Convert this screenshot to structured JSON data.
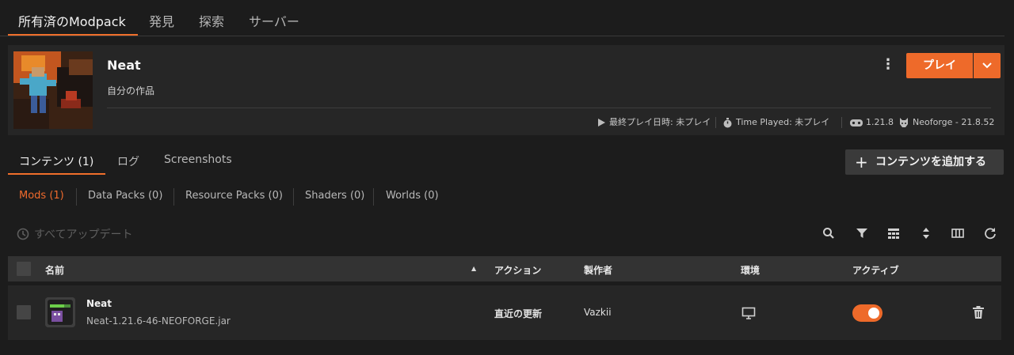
{
  "topnav": {
    "tabs": [
      {
        "label": "所有済のModpack",
        "active": true
      },
      {
        "label": "発見",
        "active": false
      },
      {
        "label": "探索",
        "active": false
      },
      {
        "label": "サーバー",
        "active": false
      }
    ]
  },
  "pack": {
    "title": "Neat",
    "subtitle": "自分の作品",
    "play_label": "プレイ",
    "meta": {
      "last_played": "最終プレイ日時: 未プレイ",
      "time_played": "Time Played: 未プレイ",
      "game_version": "1.21.8",
      "loader": "Neoforge - 21.8.52"
    }
  },
  "content_tabs": [
    {
      "label": "コンテンツ (1)",
      "active": true
    },
    {
      "label": "ログ",
      "active": false
    },
    {
      "label": "Screenshots",
      "active": false
    }
  ],
  "add_content_label": "コンテンツを追加する",
  "filters": [
    {
      "label": "Mods (1)",
      "active": true
    },
    {
      "label": "Data Packs (0)",
      "active": false
    },
    {
      "label": "Resource Packs (0)",
      "active": false
    },
    {
      "label": "Shaders (0)",
      "active": false
    },
    {
      "label": "Worlds (0)",
      "active": false
    }
  ],
  "update_all_label": "すべてアップデート",
  "table": {
    "headers": {
      "name": "名前",
      "sort_indicator": "▲",
      "action": "アクション",
      "author": "製作者",
      "environment": "環境",
      "active": "アクティブ"
    },
    "rows": [
      {
        "name": "Neat",
        "file": "Neat-1.21.6-46-NEOFORGE.jar",
        "action": "直近の更新",
        "author": "Vazkii",
        "environment_icon": "desktop-icon",
        "active": true
      }
    ]
  },
  "colors": {
    "accent": "#ee6a2a",
    "background": "#1c1c1c",
    "card": "#262626"
  }
}
